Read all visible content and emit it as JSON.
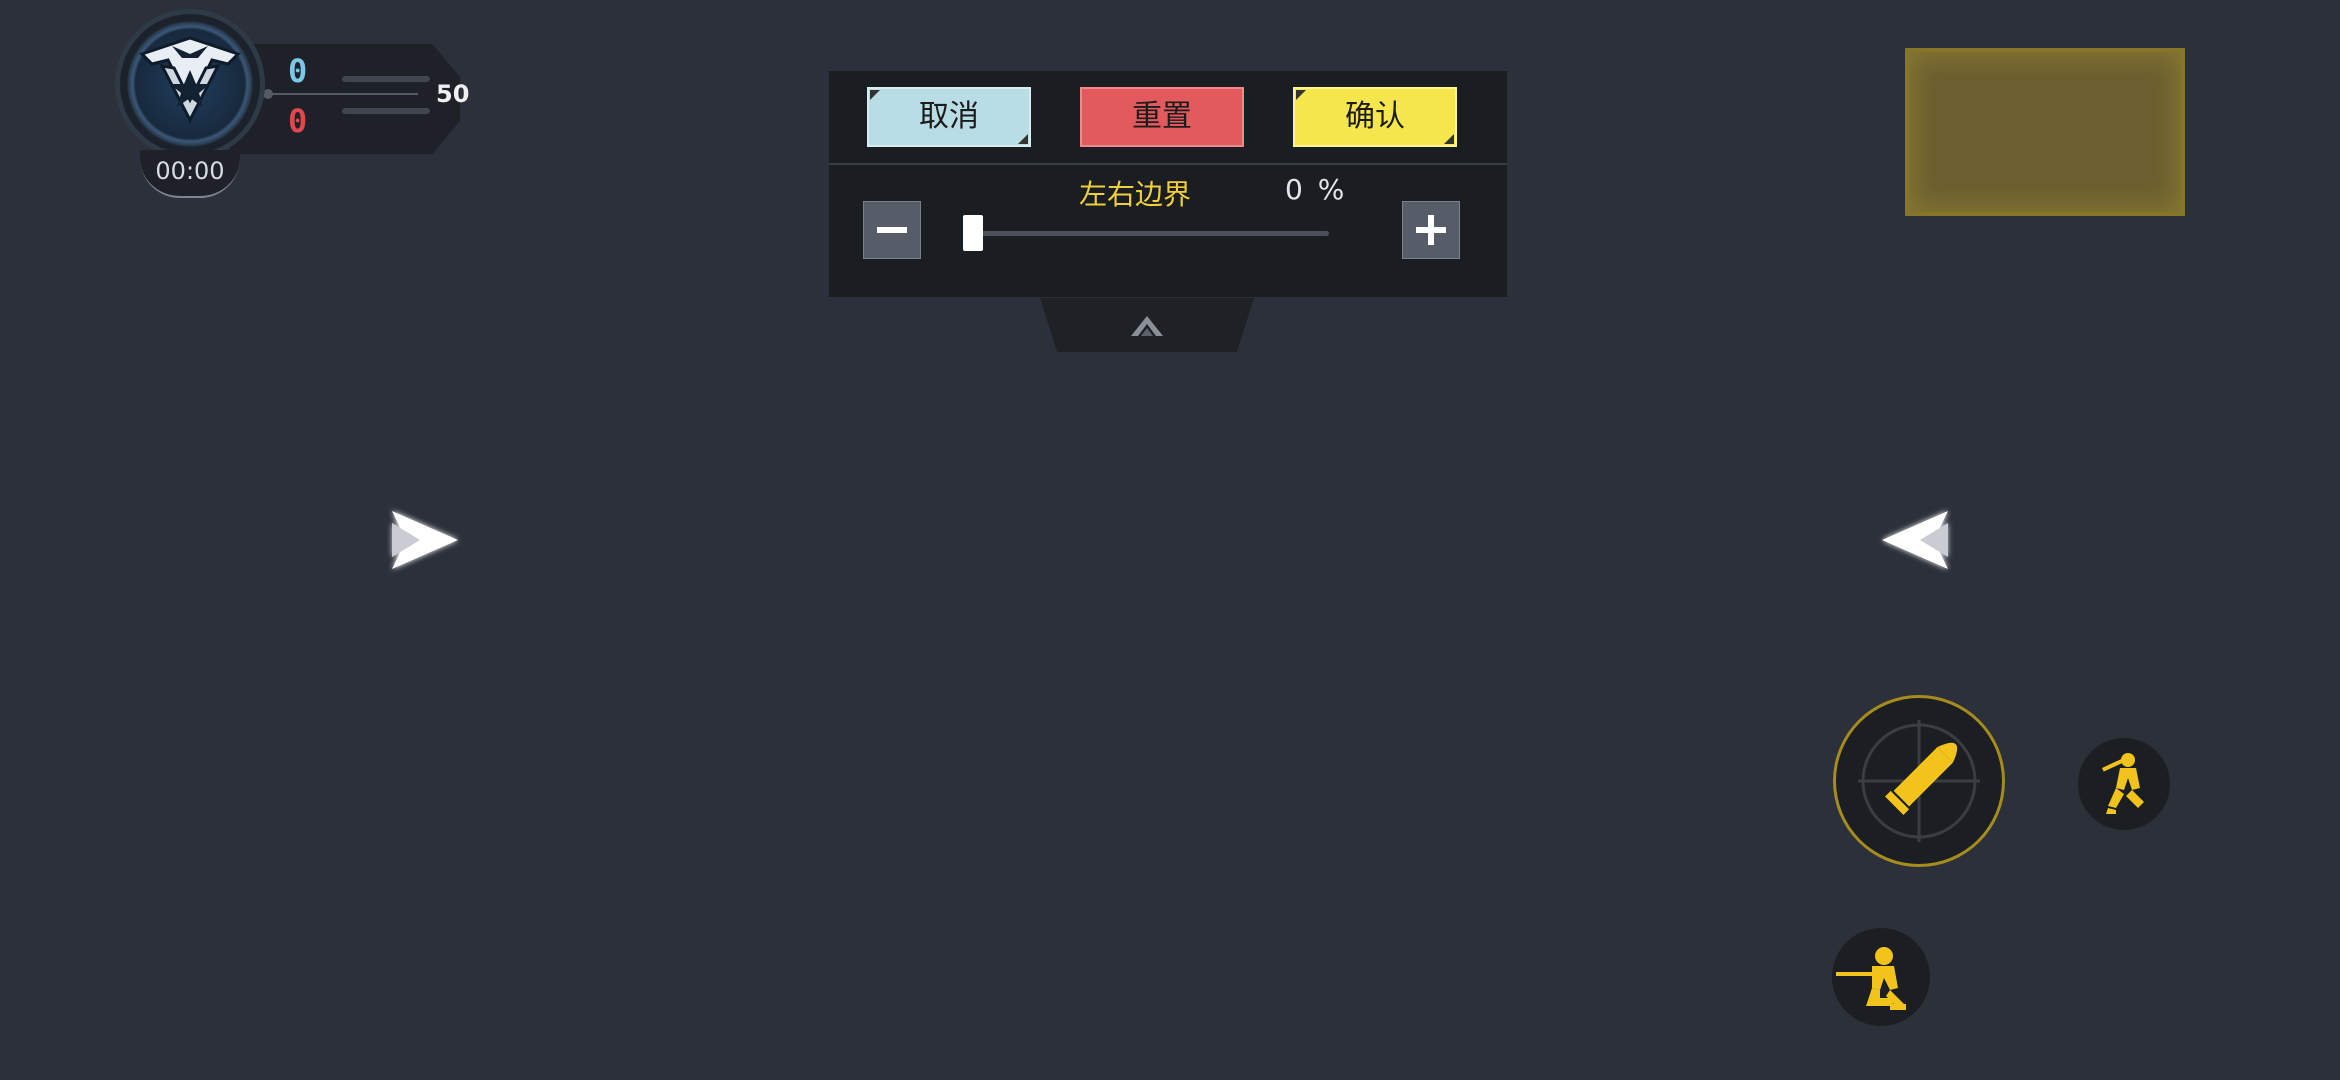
{
  "hud": {
    "team_blue_score": "0",
    "team_red_score": "0",
    "target_score": "50",
    "timer": "00:00",
    "colors": {
      "blue": "#7cc6e8",
      "red": "#e0484e"
    },
    "emblem_icon": "eagle-star-emblem-icon"
  },
  "settings_panel": {
    "cancel_label": "取消",
    "reset_label": "重置",
    "confirm_label": "确认",
    "slider": {
      "label": "左右边界",
      "value": "0 %",
      "fraction": 0.0
    },
    "minus_icon": "minus-icon",
    "plus_icon": "plus-icon",
    "collapse_icon": "chevron-up-icon",
    "colors": {
      "cancel": "#b8dde4",
      "reset": "#e25a5e",
      "confirm": "#f5e64e",
      "label": "#f0cf3c"
    }
  },
  "minimap": {
    "color": "#6f6230"
  },
  "controls": {
    "left_arrow_icon": "double-chevron-right-icon",
    "right_arrow_icon": "double-chevron-left-icon",
    "fire_icon": "bullet-crosshair-icon",
    "prone_icon": "soldier-prone-icon",
    "crouch_icon": "soldier-crouch-icon",
    "accent": "#f2c31a"
  }
}
